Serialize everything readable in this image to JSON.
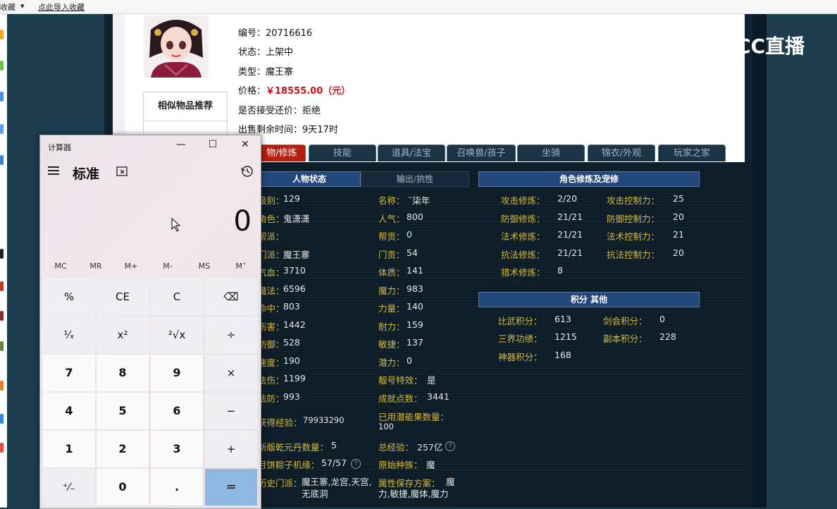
{
  "browser": {
    "bookmarks_label": "收藏",
    "import_link": "点此导入收藏"
  },
  "item": {
    "id_label": "编号：",
    "id_value": "20716616",
    "status_label": "状态：",
    "status_value": "上架中",
    "type_label": "类型：",
    "type_value": "魔王寨",
    "price_label": "价格：",
    "price_value": "￥18555.00（元）",
    "bargain_label": "是否接受还价：",
    "bargain_value": "拒绝",
    "remaining_label": "出售剩余时间：",
    "remaining_value": "9天17时"
  },
  "similar_title": "相似物品推荐",
  "tabs": [
    "人物/修炼",
    "技能",
    "道具/法宝",
    "召唤兽/孩子",
    "坐骑",
    "锦衣/外观",
    "玩家之家"
  ],
  "tab_active_visible": "物/修炼",
  "headers": {
    "status": "人物状态",
    "resist": "输出/抗性",
    "cultivation": "角色修炼及宠修",
    "points": "积分 其他"
  },
  "col1": [
    {
      "label": "级别：",
      "value": "129",
      "visible_label": "级别："
    },
    {
      "label": "角色：",
      "value": "鬼潇潇",
      "visible_label": "角色："
    },
    {
      "label": "门派：",
      "value": "",
      "visible_label": "帮派："
    },
    {
      "label": "门派：",
      "value": "魔王寨",
      "visible_label": "门派："
    },
    {
      "label": "气血：",
      "value": "3710",
      "visible_label": "气血："
    },
    {
      "label": "魔法：",
      "value": "6596",
      "visible_label": "魔法："
    },
    {
      "label": "命中：",
      "value": "803",
      "visible_label": "命中："
    },
    {
      "label": "伤害：",
      "value": "1442",
      "visible_label": "伤害："
    },
    {
      "label": "防御：",
      "value": "528",
      "visible_label": "防御："
    },
    {
      "label": "速度：",
      "value": "190",
      "visible_label": "速度："
    },
    {
      "label": "法伤：",
      "value": "1199",
      "visible_label": "法伤："
    },
    {
      "label": "法防：",
      "value": "993",
      "visible_label": "法防："
    }
  ],
  "col1_extra": {
    "exp_label": "获得经验：",
    "exp_value": "79933290",
    "qianyuan_label": "新版乾元丹数量：",
    "qianyuan_value": "5",
    "zongzi_label": "月饼粽子机缘：",
    "zongzi_value": "57/57",
    "history_label": "历史门派：",
    "history_value": "魔王寨,龙宫,天宫,无底洞"
  },
  "col2": [
    {
      "label": "名称：",
      "value": "¨柒年"
    },
    {
      "label": "人气：",
      "value": "800"
    },
    {
      "label": "帮贡：",
      "value": "0"
    },
    {
      "label": "门贡：",
      "value": "54"
    },
    {
      "label": "体质：",
      "value": "141"
    },
    {
      "label": "魔力：",
      "value": "983"
    },
    {
      "label": "力量：",
      "value": "140"
    },
    {
      "label": "耐力：",
      "value": "159"
    },
    {
      "label": "敏捷：",
      "value": "137"
    },
    {
      "label": "潜力：",
      "value": "0"
    },
    {
      "label": "靓号特效：",
      "value": "是"
    },
    {
      "label": "成就点数：",
      "value": "3441"
    }
  ],
  "col2_extra": {
    "fruit_label": "已用潜能果数量：",
    "fruit_value": "100",
    "total_exp_label": "总经验：",
    "total_exp_value": "257亿",
    "race_label": "原始种族：",
    "race_value": "魔",
    "attr_label": "属性保存方案：",
    "attr_value": "魔力,敏捷,魔体,魔力"
  },
  "cultivation": [
    {
      "label": "攻击修炼：",
      "value": "2/20",
      "label2": "攻击控制力：",
      "value2": "25"
    },
    {
      "label": "防御修炼：",
      "value": "21/21",
      "label2": "防御控制力：",
      "value2": "20"
    },
    {
      "label": "法术修炼：",
      "value": "21/21",
      "label2": "法术控制力：",
      "value2": "21"
    },
    {
      "label": "抗法修炼：",
      "value": "21/21",
      "label2": "抗法控制力：",
      "value2": "20"
    },
    {
      "label": "猎术修炼：",
      "value": "8",
      "label2": "",
      "value2": ""
    }
  ],
  "points": [
    {
      "label": "比武积分：",
      "value": "613",
      "label2": "剑会积分：",
      "value2": "0"
    },
    {
      "label": "三界功绩：",
      "value": "1215",
      "label2": "副本积分：",
      "value2": "228"
    },
    {
      "label": "神器积分：",
      "value": "168",
      "label2": "",
      "value2": ""
    }
  ],
  "watermark": "CC直播",
  "calculator": {
    "title": "计算器",
    "mode": "标准",
    "display": "0",
    "memory": [
      "MC",
      "MR",
      "M+",
      "M-",
      "MS",
      "M˅"
    ],
    "keys": [
      "%",
      "CE",
      "C",
      "⌫",
      "¹⁄ₓ",
      "x²",
      "²√x",
      "÷",
      "7",
      "8",
      "9",
      "×",
      "4",
      "5",
      "6",
      "−",
      "1",
      "2",
      "3",
      "+",
      "⁺⁄₋",
      "0",
      ".",
      "="
    ],
    "window_buttons": [
      "—",
      "☐",
      "✕"
    ]
  },
  "colors": {
    "accent_tab": "#b3200f",
    "label_gold": "#d8b93a",
    "price_red": "#d0101a",
    "equals_blue": "#8db8e2"
  }
}
